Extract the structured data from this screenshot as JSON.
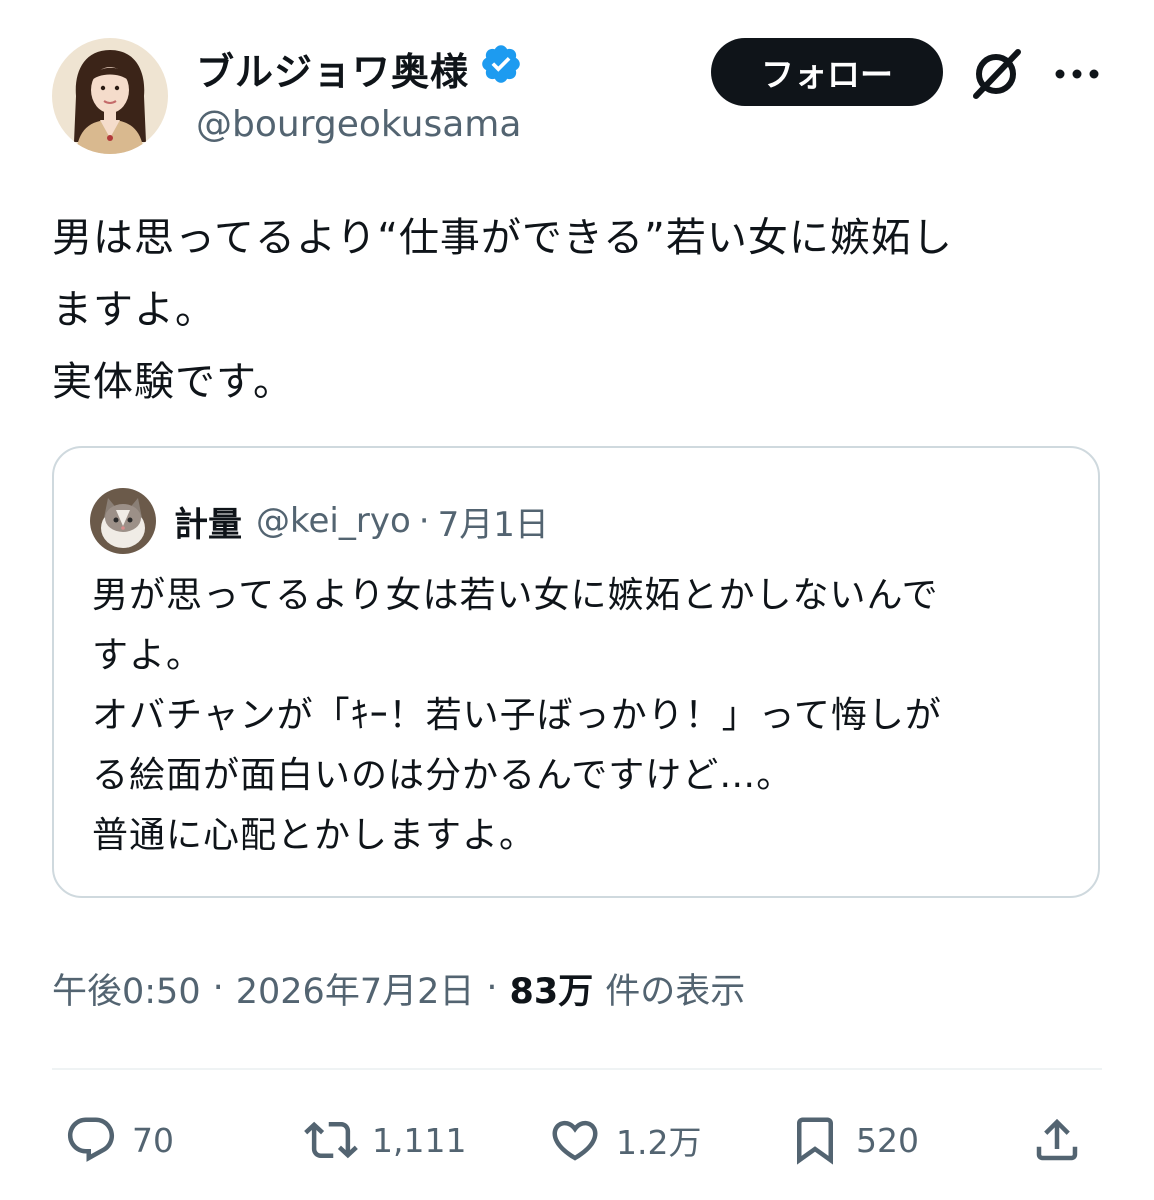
{
  "author": {
    "display_name": "ブルジョワ奥様",
    "handle": "@bourgeokusama",
    "verified": true
  },
  "follow_button": "フォロー",
  "tweet_lines": [
    "男は思ってるより“仕事ができる”若い女に嫉妬し",
    "ますよ。",
    "実体験です。"
  ],
  "quote": {
    "name": "計量",
    "handle": "@kei_ryo",
    "separator": "·",
    "date": "7月1日",
    "lines": [
      "男が思ってるより女は若い女に嫉妬とかしないんで",
      "すよ。",
      "オバチャンが「ｷｰ！若い子ばっかり！」って悔しが",
      "る絵面が面白いのは分かるんですけど…。",
      "普通に心配とかしますよ。"
    ]
  },
  "meta": {
    "time": "午後0:50",
    "separator": "·",
    "date": "2026年7月2日",
    "views_count": "83万",
    "views_label": "件の表示"
  },
  "actions": {
    "replies": "70",
    "retweets": "1,111",
    "likes": "1.2万",
    "bookmarks": "520"
  },
  "colors": {
    "text": "#0f1419",
    "secondary": "#536471",
    "verified": "#1d9bf0",
    "border": "#cfd9de",
    "follow_bg": "#0f1419"
  }
}
